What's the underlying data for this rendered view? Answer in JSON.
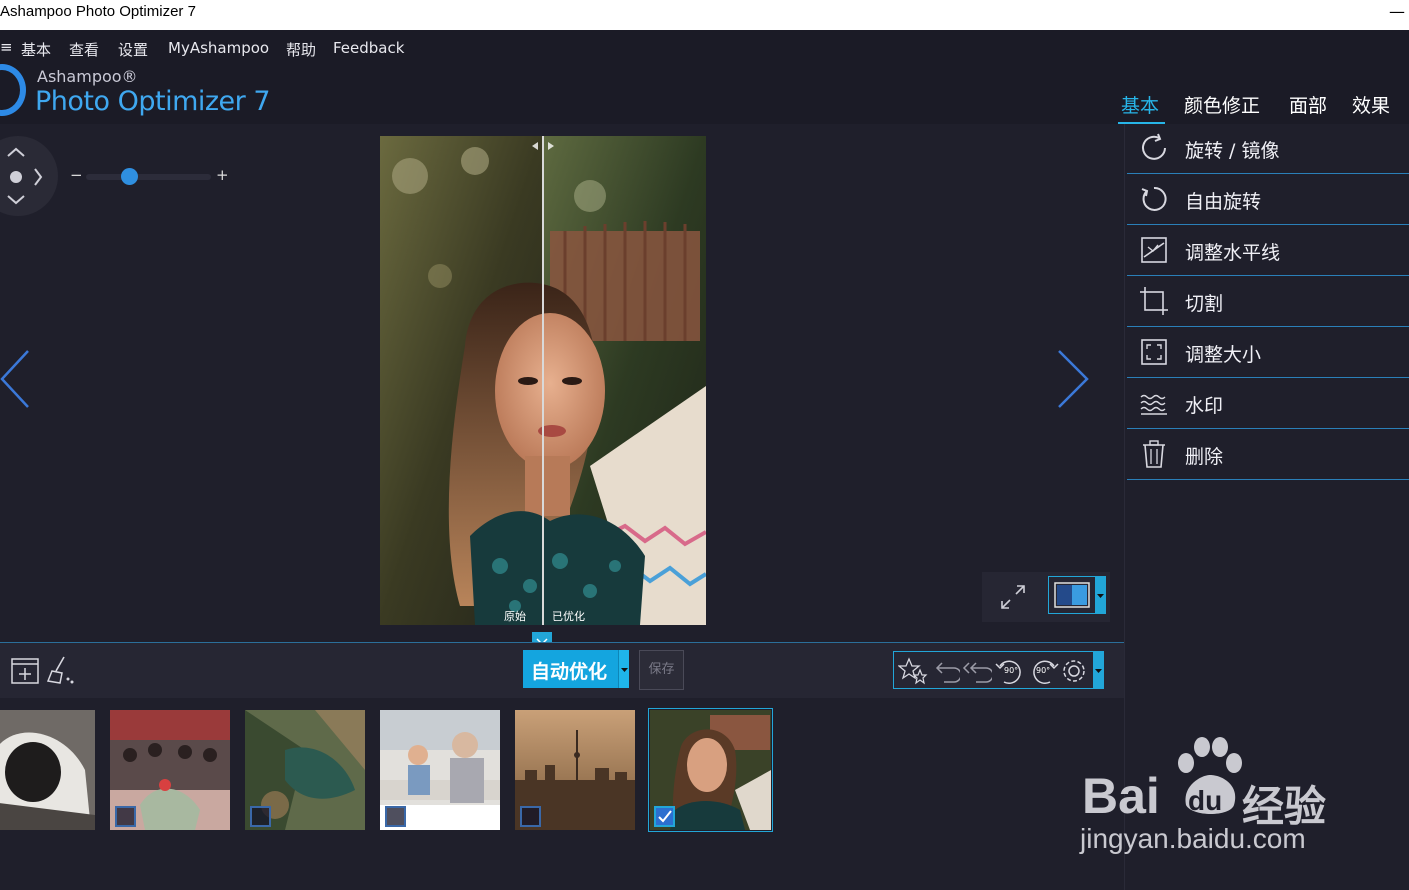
{
  "window": {
    "title": "Ashampoo Photo Optimizer 7",
    "minimize_glyph": "—"
  },
  "menu": {
    "items": [
      "基本",
      "查看",
      "设置",
      "MyAshampoo",
      "帮助",
      "Feedback"
    ]
  },
  "brand": {
    "small": "Ashampoo®",
    "large": "Photo Optimizer 7"
  },
  "tabs": [
    {
      "label": "基本",
      "active": true
    },
    {
      "label": "颜色修正",
      "active": false
    },
    {
      "label": "面部",
      "active": false
    },
    {
      "label": "效果",
      "active": false
    }
  ],
  "zoom": {
    "minus": "−",
    "plus": "+",
    "level": 0.33
  },
  "compare": {
    "left_label": "原始",
    "right_label": "已优化"
  },
  "tools": [
    {
      "label": "旋转 / 镜像",
      "icon": "rotate-mirror-icon"
    },
    {
      "label": "自由旋转",
      "icon": "free-rotate-icon"
    },
    {
      "label": "调整水平线",
      "icon": "horizon-icon"
    },
    {
      "label": "切割",
      "icon": "crop-icon"
    },
    {
      "label": "调整大小",
      "icon": "resize-icon"
    },
    {
      "label": "水印",
      "icon": "watermark-icon"
    },
    {
      "label": "删除",
      "icon": "trash-icon"
    }
  ],
  "toolbar": {
    "auto_label": "自动优化",
    "save_label": "保存",
    "rot_left": "90°",
    "rot_right": "90°"
  },
  "thumbnails": [
    {
      "name": "thumb-1",
      "checked": false
    },
    {
      "name": "thumb-2",
      "checked": false
    },
    {
      "name": "thumb-3",
      "checked": false
    },
    {
      "name": "thumb-4",
      "checked": false
    },
    {
      "name": "thumb-5",
      "checked": false
    },
    {
      "name": "thumb-6",
      "checked": true
    }
  ],
  "watermark": {
    "brand": "Bai",
    "brand2": "du",
    "cn": "经验",
    "url": "jingyan.baidu.com"
  },
  "colors": {
    "accent": "#27b5e8",
    "brand_blue": "#3fa8f0",
    "background": "#1f1f2b"
  }
}
